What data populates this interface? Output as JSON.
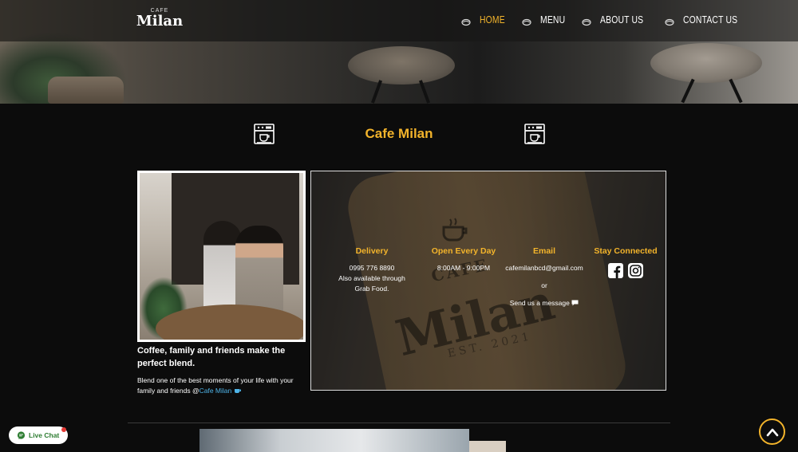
{
  "header": {
    "logo_small": "CAFE",
    "logo_big": "Milan",
    "nav": [
      {
        "label": "HOME",
        "active": true
      },
      {
        "label": "MENU",
        "active": false
      },
      {
        "label": "ABOUT US",
        "active": false
      },
      {
        "label": "CONTACT US",
        "active": false
      }
    ]
  },
  "section": {
    "title": "Cafe Milan"
  },
  "story": {
    "headline": "Coffee, family and friends make the perfect blend.",
    "body": "Blend one of the best moments of your life with your family and friends @",
    "link": "Cafe Milan"
  },
  "info": {
    "backdrop": {
      "cafe": "CAFE",
      "name": "Milan",
      "est": "EST. 2021"
    },
    "delivery": {
      "title": "Delivery",
      "phone": "0995 776 8890",
      "note1": "Also available through",
      "note2": "Grab Food."
    },
    "hours": {
      "title": "Open Every Day",
      "time": "8:00AM - 9:00PM"
    },
    "email": {
      "title": "Email",
      "address": "cafemilanbcd@gmail.com",
      "or": "or",
      "message": "Send us a message"
    },
    "social": {
      "title": "Stay Connected",
      "icons": [
        "facebook-icon",
        "instagram-icon"
      ]
    }
  },
  "widgets": {
    "live_chat": "Live Chat"
  },
  "colors": {
    "accent": "#f3b42b",
    "background": "#0c0c0c",
    "link": "#4fb4e8"
  }
}
